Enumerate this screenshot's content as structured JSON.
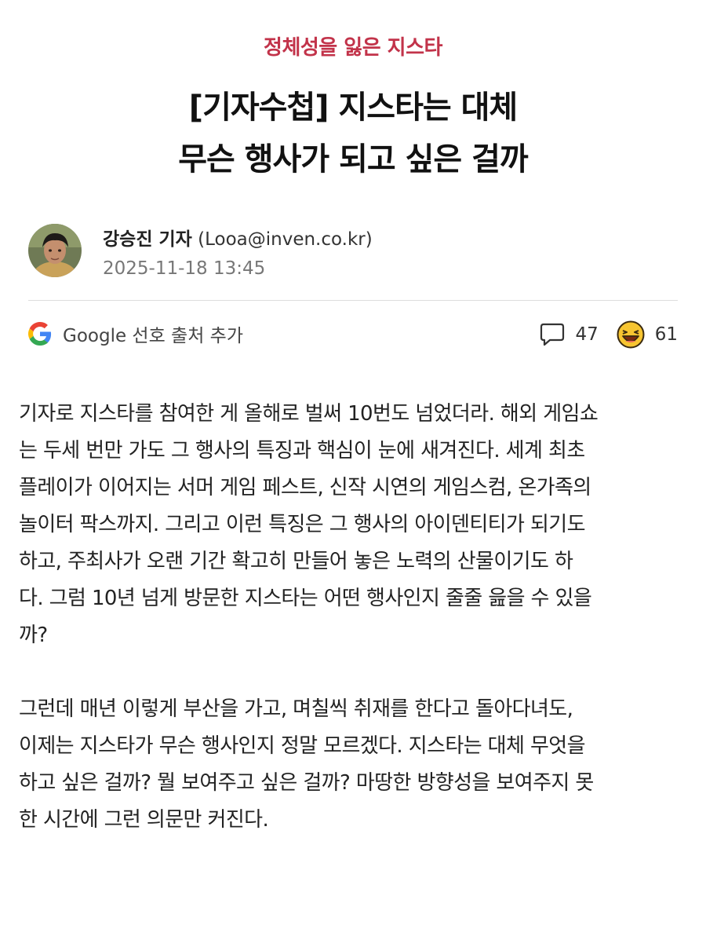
{
  "category": "정체성을 잃은 지스타",
  "headline": {
    "line1": "[기자수첩] 지스타는 대체",
    "line2": "무슨 행사가 되고 싶은 걸까"
  },
  "author": {
    "name": "강승진 기자",
    "email": "(Looa@inven.co.kr)",
    "date": "2025-11-18 13:45"
  },
  "toolbar": {
    "google_label": "Google 선호 출처 추가",
    "comment_count": "47",
    "reaction_count": "61",
    "icons": {
      "google": "google-logo-icon",
      "comment": "comment-bubble-icon",
      "reaction": "laughing-emoji-icon"
    }
  },
  "article": {
    "paragraph1": [
      "기자로 지스타를 참여한 게 올해로 벌써 10번도 넘었더라. 해외 게임쇼",
      "는 두세 번만 가도 그 행사의 특징과 핵심이 눈에 새겨진다. 세계 최초",
      "플레이가 이어지는 서머 게임 페스트, 신작 시연의 게임스컴, 온가족의",
      "놀이터 팍스까지. 그리고 이런 특징은 그 행사의 아이덴티티가 되기도",
      "하고, 주최사가 오랜 기간 확고히 만들어 놓은 노력의 산물이기도 하",
      "다. 그럼 10년 넘게 방문한 지스타는 어떤 행사인지 줄줄 읊을 수 있을",
      "까?"
    ],
    "paragraph2": [
      "그런데 매년 이렇게 부산을 가고, 며칠씩 취재를 한다고 돌아다녀도,",
      "이제는 지스타가 무슨 행사인지 정말 모르겠다. 지스타는 대체 무엇을",
      "하고 싶은 걸까? 뭘 보여주고 싶은 걸까? 마땅한 방향성을 보여주지 못",
      "한 시간에 그런 의문만 커진다."
    ]
  },
  "colors": {
    "category": "#c2334a",
    "headline": "#111111",
    "body_text": "#222222",
    "date": "#777777",
    "emoji": "#f7c531"
  }
}
